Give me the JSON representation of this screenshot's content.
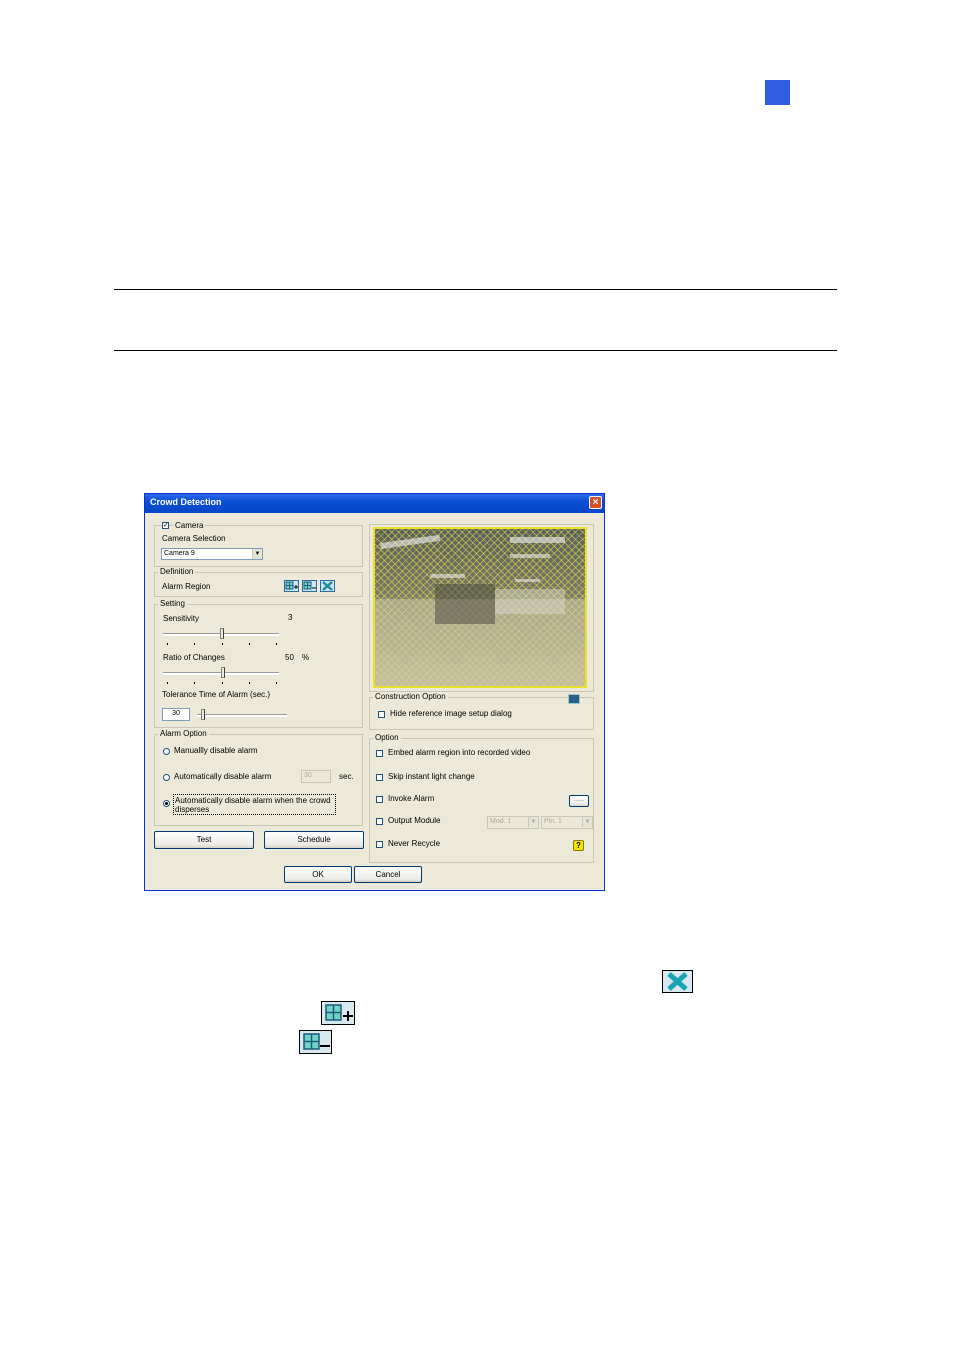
{
  "dialog": {
    "title": "Crowd Detection",
    "camera": {
      "label": "Camera",
      "checked": true,
      "selection_label": "Camera Selection",
      "selection_value": "Camera 9"
    },
    "definition": {
      "legend": "Definition",
      "alarm_region_label": "Alarm Region"
    },
    "setting": {
      "legend": "Setting",
      "sensitivity_label": "Sensitivity",
      "sensitivity_value": "3",
      "ratio_label": "Ratio of Changes",
      "ratio_value": "50",
      "ratio_unit": "%",
      "tolerance_label": "Tolerance Time of Alarm (sec.)",
      "tolerance_value": "30"
    },
    "alarm_option": {
      "legend": "Alarm Option",
      "manual_label": "Manuallly disable alarm",
      "auto_label": "Automatically disable alarm",
      "auto_value": "30",
      "auto_unit": "sec.",
      "crowd_label_line1": "Automatically disable alarm when the crowd",
      "crowd_label_line2": "disperses",
      "selected": "crowd"
    },
    "buttons": {
      "test": "Test",
      "schedule": "Schedule",
      "ok": "OK",
      "cancel": "Cancel"
    },
    "construction_option": {
      "legend": "Construction Option",
      "hide_label": "Hide reference image setup dialog"
    },
    "option": {
      "legend": "Option",
      "embed_label": "Embed alarm region into recorded video",
      "skip_label": "Skip instant light change",
      "invoke_label": "Invoke Alarm",
      "invoke_button": "......",
      "output_label": "Output Module",
      "module_value": "Mod. 1",
      "pin_value": "Pin. 1",
      "recycle_label": "Never Recycle"
    }
  },
  "colors": {
    "dialog_bg": "#ece9d8",
    "titlebar": "#0a4fd6",
    "region_overlay": "#e9e12e",
    "page_marker": "#2f5fe0"
  },
  "icons": [
    "add-region-icon",
    "remove-region-icon",
    "clear-region-icon",
    "help-icon",
    "camera-icon"
  ]
}
